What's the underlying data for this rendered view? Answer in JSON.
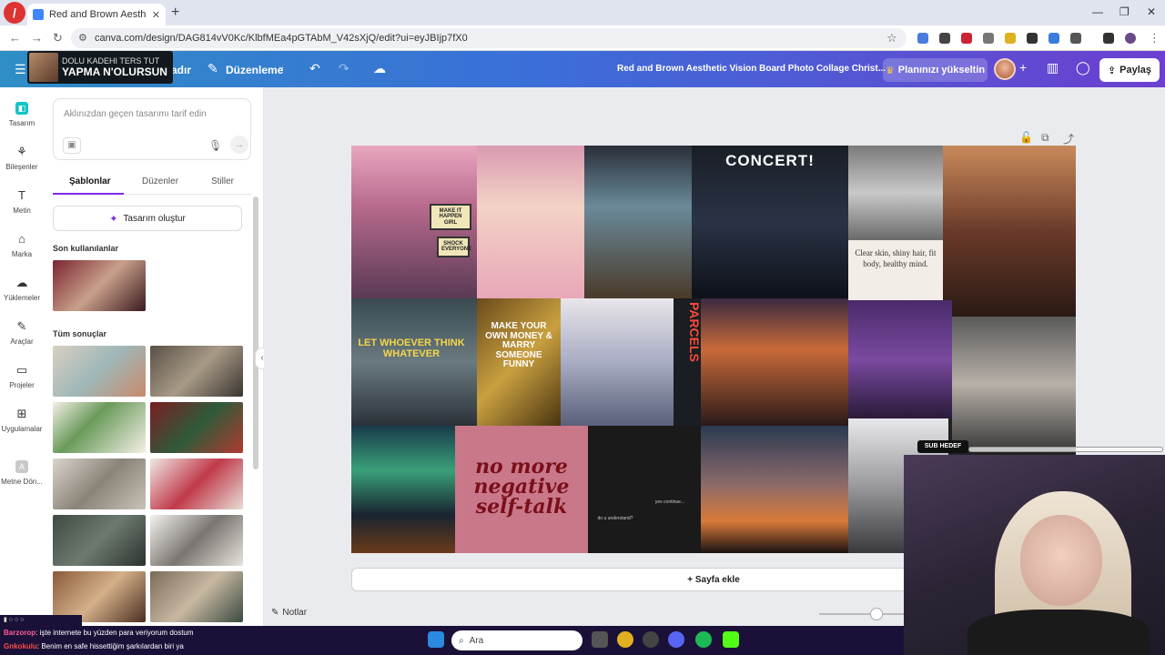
{
  "browser": {
    "tab_title": "Red and Brown Aesthetic Vision",
    "url": "canva.com/design/DAG814vV0Kc/KlbfMEa4pGTAbM_V42sXjQ/edit?ui=eyJBIjp7fX0"
  },
  "header": {
    "menu_text": "adır",
    "edit_label": "Düzenleme",
    "doc_title": "Red and Brown Aesthetic Vision Board Photo Collage Christ...",
    "upgrade_label": "Planınızı yükseltin",
    "share_label": "Paylaş"
  },
  "overlay_banner": {
    "line1": "DOLU KADEHI TERS TUT",
    "line2": "YAPMA N'OLURSUN"
  },
  "rail": {
    "items": [
      {
        "label": "Tasarım"
      },
      {
        "label": "Bileşenler"
      },
      {
        "label": "Metin"
      },
      {
        "label": "Marka"
      },
      {
        "label": "Yüklemeler"
      },
      {
        "label": "Araçlar"
      },
      {
        "label": "Projeler"
      },
      {
        "label": "Uygulamalar"
      },
      {
        "label": "Metne Dön..."
      }
    ]
  },
  "panel": {
    "prompt_placeholder": "Aklınızdan geçen tasarımı tarif edin",
    "tabs": [
      {
        "label": "Şablonlar"
      },
      {
        "label": "Düzenler"
      },
      {
        "label": "Stiller"
      }
    ],
    "create_button": "Tasarım oluştur",
    "recent_title": "Son kullanılanlar",
    "results_title": "Tüm sonuçlar"
  },
  "collage": {
    "tile_texts": {
      "sign": "MAKE IT HAPPEN GIRL",
      "sign2": "SHOCK EVERYONE",
      "concert": "CONCERT!",
      "affirm": "Clear skin, shiny hair, fit body, healthy mind.",
      "let": "LET WHOEVER THINK WHATEVER",
      "money": "MAKE YOUR OWN MONEY & MARRY SOMEONE FUNNY",
      "parcels": "PARCELS",
      "negative": "no more negative self-talk",
      "yes": "yes continue...",
      "understand": "do u understand?"
    }
  },
  "canvas": {
    "add_page": "+ Sayfa ekle",
    "notes": "Notlar"
  },
  "stream": {
    "sub_label": "SUB HEDEF",
    "chat": [
      {
        "user": "Barzorop",
        "text": ": işte internete bu yüzden para veriyorum dostum"
      },
      {
        "user": "Gnkokulu",
        "text": ": Benim en safe hissettiğim şarkılardan biri ya"
      }
    ],
    "taskbar_search": "Ara"
  },
  "colors": {
    "canva_gradient_start": "#2f8ec6",
    "canva_gradient_end": "#6c3fd0",
    "accent_purple": "#7d2ae8",
    "negative_tile": "#c9788a"
  }
}
